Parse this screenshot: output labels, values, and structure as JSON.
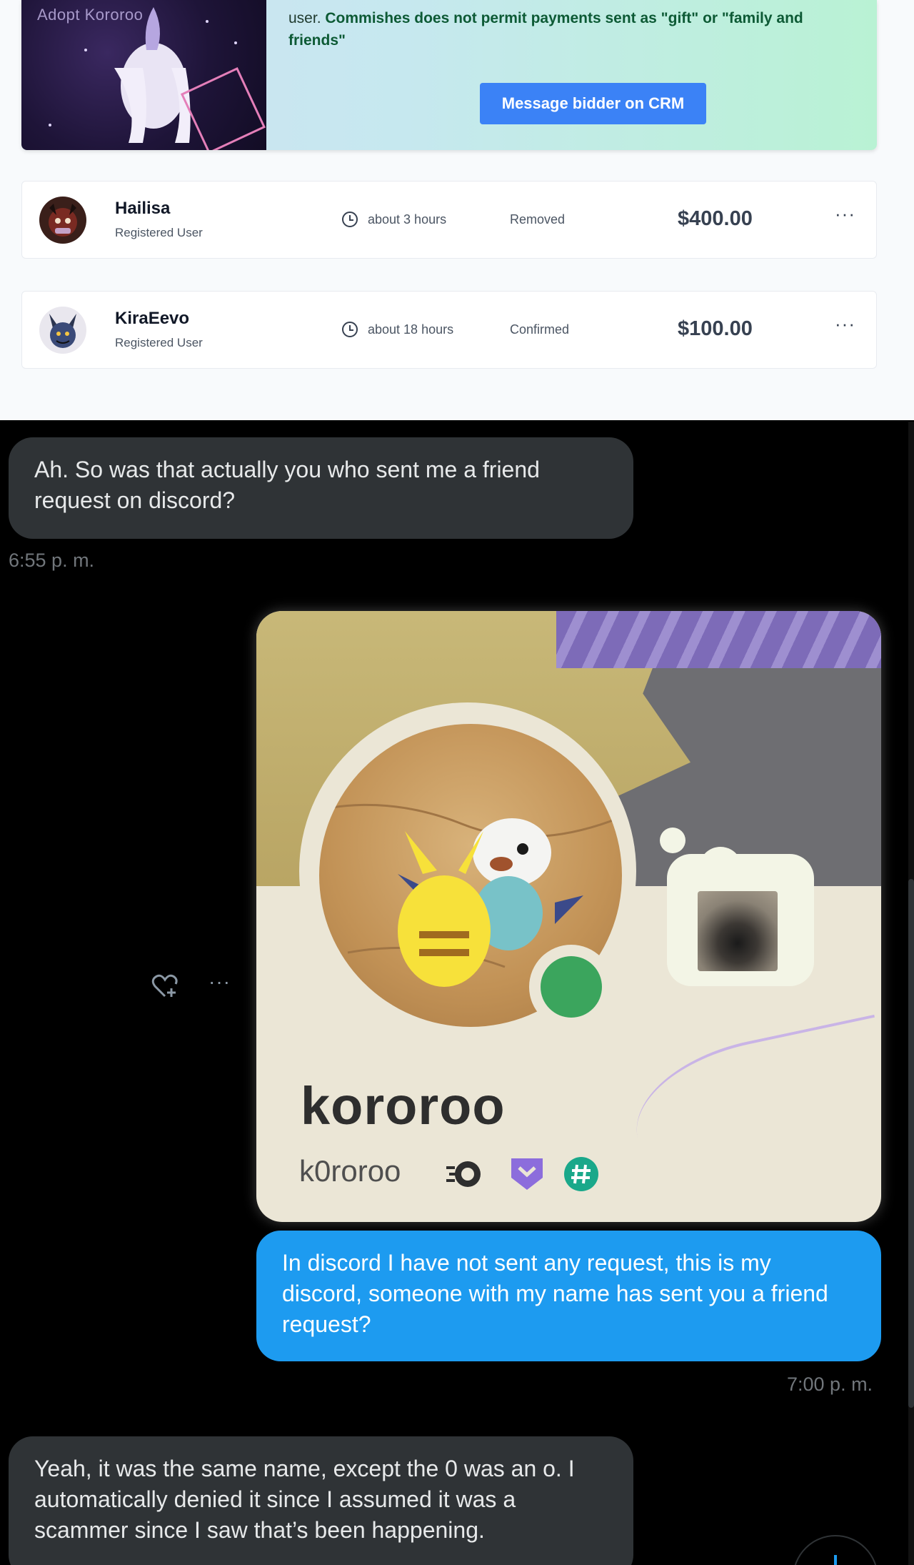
{
  "auction": {
    "banner_text_plain": "user.",
    "banner_text_bold": "Commishes does not permit payments sent as \"gift\" or \"family and friends\"",
    "banner_watermark": "Adopt Kororoo",
    "message_button": "Message bidder on CRM",
    "bids": [
      {
        "name": "Hailisa",
        "role": "Registered User",
        "time": "about 3 hours",
        "status": "Removed",
        "amount": "$400.00",
        "more": "···"
      },
      {
        "name": "KiraEevo",
        "role": "Registered User",
        "time": "about 18 hours",
        "status": "Confirmed",
        "amount": "$100.00",
        "more": "···"
      }
    ]
  },
  "chat": {
    "messages": [
      {
        "direction": "incoming",
        "text": "Ah. So was that actually you who sent me a friend request on discord?",
        "time": "6:55 p. m."
      },
      {
        "direction": "outgoing",
        "type": "image",
        "card": {
          "display_name": "kororoo",
          "username": "k0roroo"
        }
      },
      {
        "direction": "outgoing",
        "text": "In discord I have not sent any request, this is my discord, someone with my name has sent you a friend request?",
        "time": "7:00 p. m."
      },
      {
        "direction": "incoming",
        "text": "Yeah, it was the same name, except the 0 was an o. I automatically denied it since I assumed it was a scammer since I saw that’s been happening."
      }
    ],
    "reaction_more": "···"
  },
  "colors": {
    "crm_button": "#3b82f6",
    "incoming_bubble": "#2f3336",
    "outgoing_bubble": "#1d9bf0",
    "online_status": "#3ba55d"
  },
  "icons": [
    "clock-icon",
    "more-icon",
    "heart-plus-icon",
    "hypesquad-badge-icon",
    "twitch-badge-icon",
    "hashtag-badge-icon",
    "scroll-down-icon"
  ]
}
